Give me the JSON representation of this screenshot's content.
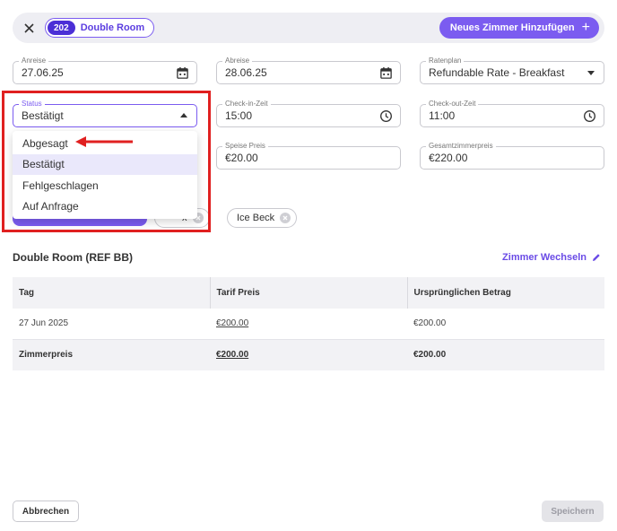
{
  "header": {
    "room_number": "202",
    "room_name": "Double Room",
    "add_room_label": "Neues Zimmer Hinzufügen"
  },
  "fields": {
    "arrival": {
      "label": "Anreise",
      "value": "27.06.25"
    },
    "departure": {
      "label": "Abreise",
      "value": "28.06.25"
    },
    "rate_plan": {
      "label": "Ratenplan",
      "value": "Refundable Rate - Breakfast"
    },
    "status": {
      "label": "Status",
      "value": "Bestätigt"
    },
    "checkin": {
      "label": "Check-in-Zeit",
      "value": "15:00"
    },
    "checkout": {
      "label": "Check-out-Zeit",
      "value": "11:00"
    },
    "food_price": {
      "label": "Speise Preis",
      "value": "€20.00"
    },
    "total_price": {
      "label": "Gesamtzimmerpreis",
      "value": "€220.00"
    }
  },
  "status_options": [
    "Abgesagt",
    "Bestätigt",
    "Fehlgeschlagen",
    "Auf Anfrage"
  ],
  "tags": {
    "partial": "x",
    "ice_beck": "Ice Beck"
  },
  "section": {
    "title": "Double Room (REF BB)",
    "change_room": "Zimmer Wechseln"
  },
  "table": {
    "headers": [
      "Tag",
      "Tarif Preis",
      "Ursprünglichen Betrag"
    ],
    "rows": [
      [
        "27 Jun 2025",
        "€200.00",
        "€200.00"
      ]
    ],
    "total": [
      "Zimmerpreis",
      "€200.00",
      "€200.00"
    ]
  },
  "footer": {
    "cancel": "Abbrechen",
    "save": "Speichern"
  },
  "colors": {
    "accent": "#7b5cf0",
    "annotation": "#e02020"
  }
}
